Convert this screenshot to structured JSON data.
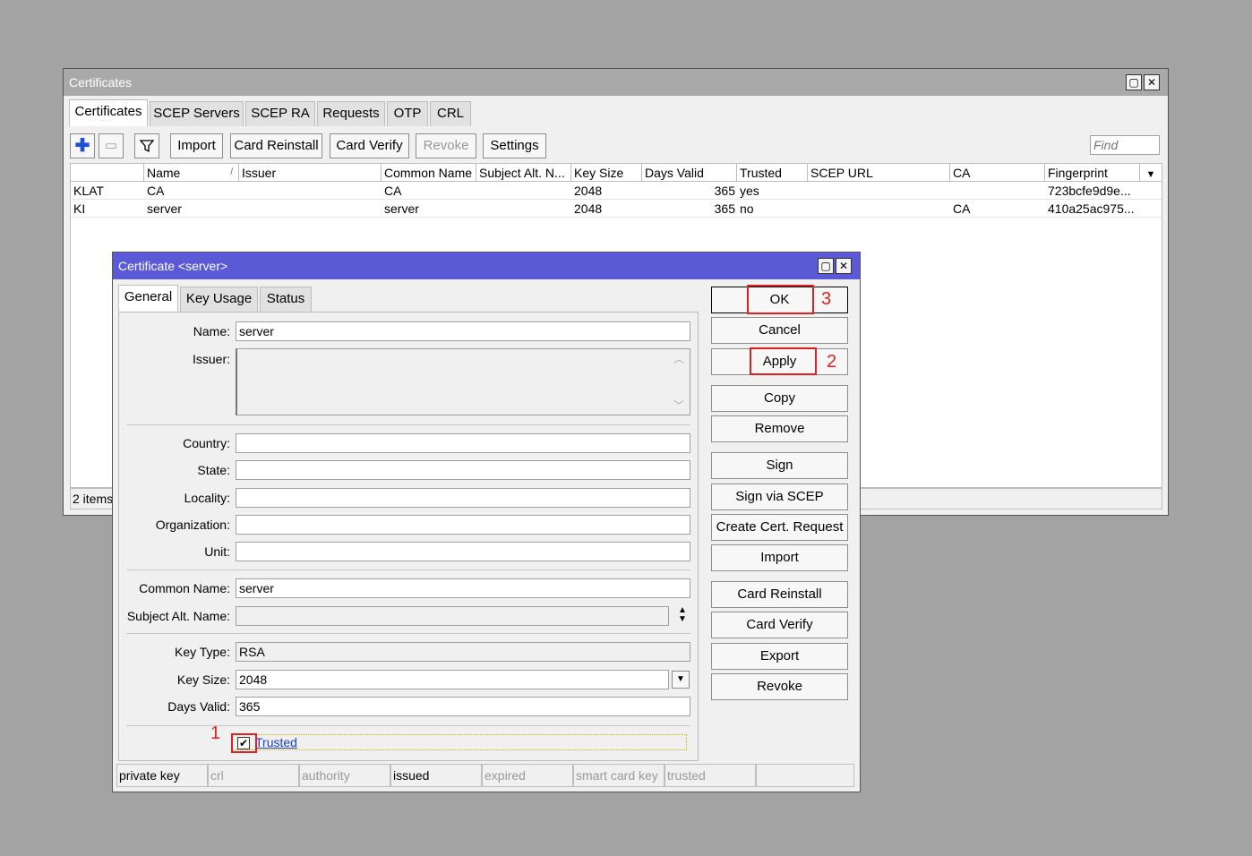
{
  "main_window": {
    "title": "Certificates",
    "tabs": [
      "Certificates",
      "SCEP Servers",
      "SCEP RA",
      "Requests",
      "OTP",
      "CRL"
    ],
    "toolbar": {
      "add_icon": "plus-icon",
      "remove_icon": "minus-icon",
      "filter_icon": "filter-icon",
      "import": "Import",
      "card_reinstall": "Card Reinstall",
      "card_verify": "Card Verify",
      "revoke": "Revoke",
      "settings": "Settings",
      "find_placeholder": "Find"
    },
    "columns": [
      "",
      "Name",
      "Issuer",
      "Common Name",
      "Subject Alt. N...",
      "Key Size",
      "Days Valid",
      "Trusted",
      "SCEP URL",
      "CA",
      "Fingerprint"
    ],
    "sort_indicator": "/",
    "rows": [
      {
        "flags": "KLAT",
        "name": "CA",
        "issuer": "",
        "common_name": "CA",
        "subject_alt": "",
        "key_size": "2048",
        "days_valid": "365",
        "trusted": "yes",
        "scep_url": "",
        "ca": "",
        "fingerprint": "723bcfe9d9e..."
      },
      {
        "flags": "KI",
        "name": "server",
        "issuer": "",
        "common_name": "server",
        "subject_alt": "",
        "key_size": "2048",
        "days_valid": "365",
        "trusted": "no",
        "scep_url": "",
        "ca": "CA",
        "fingerprint": "410a25ac975..."
      }
    ],
    "status": "2 items"
  },
  "dialog": {
    "title": "Certificate <server>",
    "tabs": [
      "General",
      "Key Usage",
      "Status"
    ],
    "fields": {
      "name": {
        "label": "Name:",
        "value": "server"
      },
      "issuer": {
        "label": "Issuer:",
        "value": ""
      },
      "country": {
        "label": "Country:",
        "value": ""
      },
      "state": {
        "label": "State:",
        "value": ""
      },
      "locality": {
        "label": "Locality:",
        "value": ""
      },
      "organization": {
        "label": "Organization:",
        "value": ""
      },
      "unit": {
        "label": "Unit:",
        "value": ""
      },
      "common_name": {
        "label": "Common Name:",
        "value": "server"
      },
      "subject_alt_name": {
        "label": "Subject Alt. Name:",
        "value": ""
      },
      "key_type": {
        "label": "Key Type:",
        "value": "RSA"
      },
      "key_size": {
        "label": "Key Size:",
        "value": "2048"
      },
      "days_valid": {
        "label": "Days Valid:",
        "value": "365"
      }
    },
    "trusted": {
      "label": "Trusted",
      "checked": true
    },
    "buttons": [
      "OK",
      "Cancel",
      "Apply",
      "Copy",
      "Remove",
      "Sign",
      "Sign via SCEP",
      "Create Cert. Request",
      "Import",
      "Card Reinstall",
      "Card Verify",
      "Export",
      "Revoke"
    ],
    "status_flags": [
      {
        "label": "private key",
        "active": true
      },
      {
        "label": "crl",
        "active": false
      },
      {
        "label": "authority",
        "active": false
      },
      {
        "label": "issued",
        "active": true
      },
      {
        "label": "expired",
        "active": false
      },
      {
        "label": "smart card key",
        "active": false
      },
      {
        "label": "trusted",
        "active": false
      },
      {
        "label": "",
        "active": false
      }
    ]
  },
  "annotations": {
    "one": "1",
    "two": "2",
    "three": "3"
  },
  "colors": {
    "main_title_bg": "#a9a9a9",
    "dialog_title_bg": "#5a5ad6",
    "highlight": "#e02020",
    "desktop": "#a3a3a3"
  }
}
